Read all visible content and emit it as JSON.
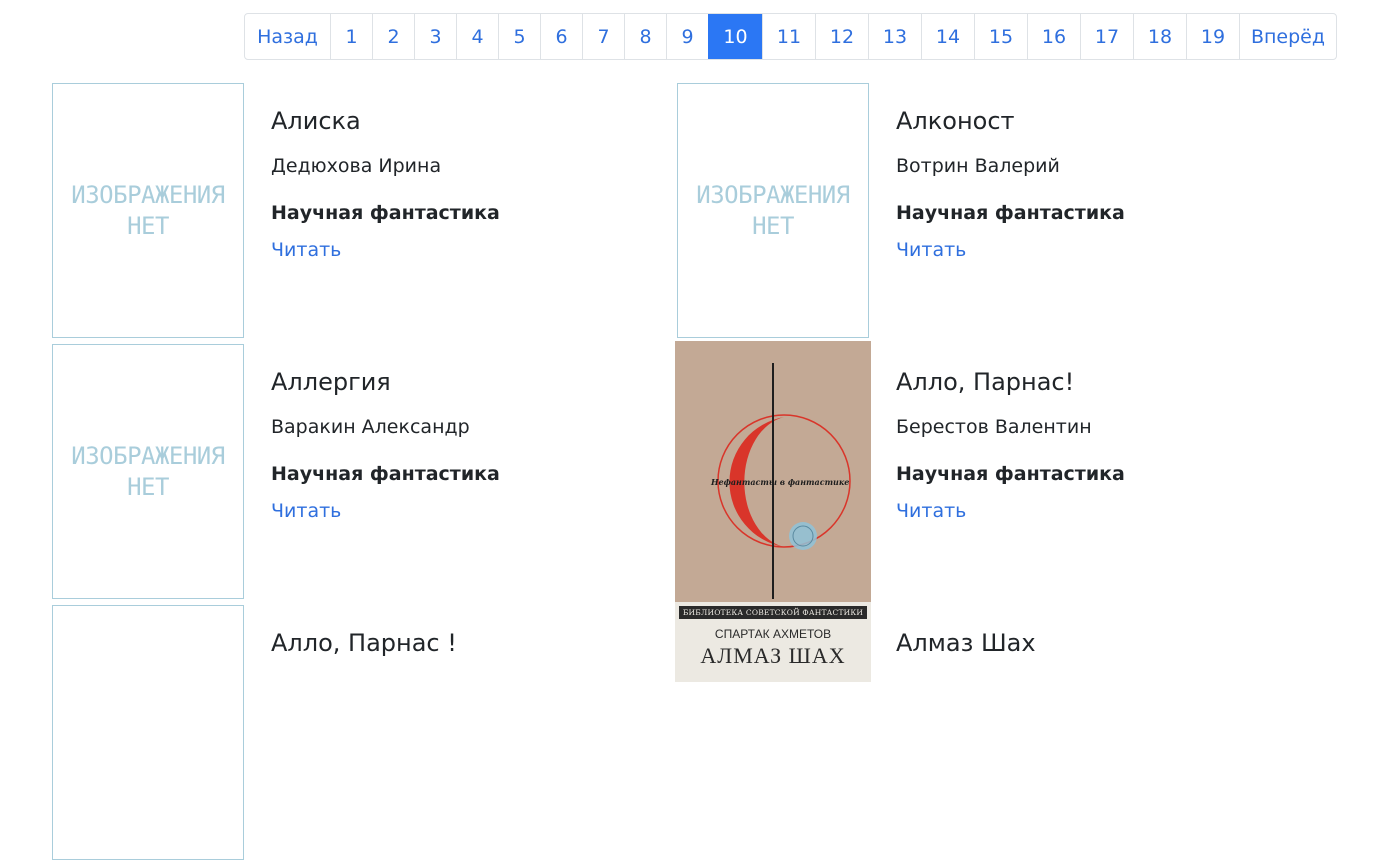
{
  "pagination": {
    "prev_label": "Назад",
    "next_label": "Вперёд",
    "pages": [
      "1",
      "2",
      "3",
      "4",
      "5",
      "6",
      "7",
      "8",
      "9",
      "10",
      "11",
      "12",
      "13",
      "14",
      "15",
      "16",
      "17",
      "18",
      "19"
    ],
    "active": "10"
  },
  "no_image": {
    "line1": "ИЗОБРАЖЕНИЯ",
    "line2": "НЕТ"
  },
  "books": [
    {
      "title": "Алиска",
      "author": "Дедюхова Ирина",
      "genre": "Научная фантастика",
      "read": "Читать"
    },
    {
      "title": "Алконост",
      "author": "Вотрин Валерий",
      "genre": "Научная фантастика",
      "read": "Читать"
    },
    {
      "title": "Аллергия",
      "author": "Варакин Александр",
      "genre": "Научная фантастика",
      "read": "Читать"
    },
    {
      "title": "Алло, Парнас!",
      "author": "Берестов Валентин",
      "genre": "Научная фантастика",
      "read": "Читать",
      "cover_text": "Нефантасты в фантастике"
    },
    {
      "title": "Алло, Парнас !"
    },
    {
      "title": "Алмаз Шах",
      "cover_series": "БИБЛИОТЕКА СОВЕТСКОЙ ФАНТАСТИКИ",
      "cover_author": "СПАРТАК АХМЕТОВ",
      "cover_title": "АЛМАЗ ШАХ"
    }
  ],
  "colors": {
    "accent": "#2b77f4",
    "link": "#2f6fde",
    "placeholder": "#a9cddb"
  }
}
